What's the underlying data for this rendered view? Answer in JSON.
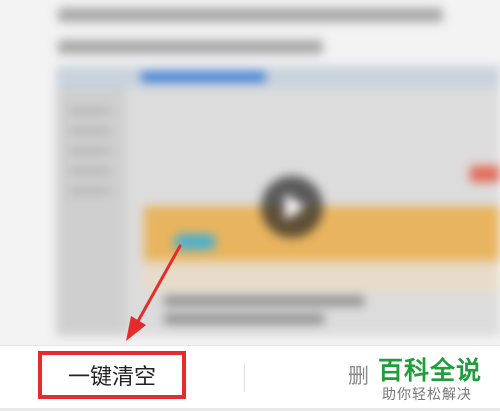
{
  "toolbar": {
    "clear_all_label": "一键清空",
    "delete_label": "删"
  },
  "watermark": {
    "title": "百科全说",
    "subtitle": "助你轻松解决"
  },
  "colors": {
    "highlight_red": "#e52b2b",
    "watermark_green": "#1f9e3b"
  },
  "icons": {
    "video": "play-icon",
    "annotation": "red-arrow"
  }
}
